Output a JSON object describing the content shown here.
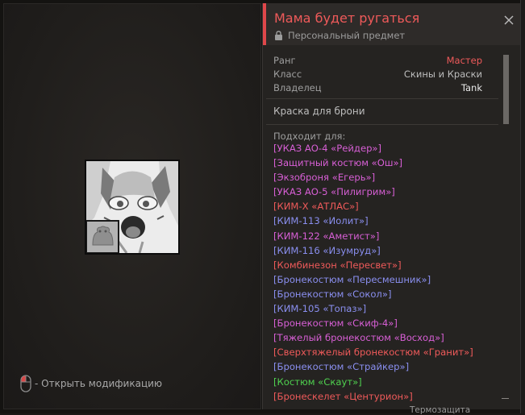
{
  "item": {
    "title": "Мама будет ругаться",
    "subtitle": "Персональный предмет",
    "properties": [
      {
        "label": "Ранг",
        "value": "Мастер"
      },
      {
        "label": "Класс",
        "value": "Скины и Краски"
      },
      {
        "label": "Владелец",
        "value": "Tank"
      }
    ],
    "description": "Краска для брони",
    "fits_label": "Подходит для:",
    "fits": [
      {
        "text": "[УКАЗ АО-4 «Рейдер»]",
        "color": "#d85fd6"
      },
      {
        "text": "[Защитный костюм «Ош»]",
        "color": "#d85fd6"
      },
      {
        "text": "[Экзоброня «Егерь»]",
        "color": "#d85fd6"
      },
      {
        "text": "[УКАЗ АО-5 «Пилигрим»]",
        "color": "#d85fd6"
      },
      {
        "text": "[КИМ-X «АТЛАС»]",
        "color": "#ef5a5a"
      },
      {
        "text": "[КИМ-113 «Иолит»]",
        "color": "#8a8ff0"
      },
      {
        "text": "[КИМ-122 «Аметист»]",
        "color": "#d85fd6"
      },
      {
        "text": "[КИМ-116 «Изумруд»]",
        "color": "#8a8ff0"
      },
      {
        "text": "[Комбинезон «Пересвет»]",
        "color": "#ef5a5a"
      },
      {
        "text": "[Бронекостюм «Пересмешник»]",
        "color": "#8a8ff0"
      },
      {
        "text": "[Бронекостюм «Сокол»]",
        "color": "#8a8ff0"
      },
      {
        "text": "[КИМ-105 «Топаз»]",
        "color": "#8a8ff0"
      },
      {
        "text": "[Бронекостюм «Скиф-4»]",
        "color": "#d85fd6"
      },
      {
        "text": "[Тяжелый бронекостюм «Восход»]",
        "color": "#d85fd6"
      },
      {
        "text": "[Сверхтяжелый бронекостюм «Гранит»]",
        "color": "#ef5a5a"
      },
      {
        "text": "[Бронекостюм «Страйкер»]",
        "color": "#8a8ff0"
      },
      {
        "text": "[Костюм «Скаут»]",
        "color": "#4fd14f"
      },
      {
        "text": "[Бронескелет «Центурион»]",
        "color": "#ef5a5a"
      }
    ]
  },
  "hint": {
    "text": "- Открыть модификацию"
  },
  "background": {
    "peek_bottom": "Термозащита"
  },
  "colors": {
    "accent": "#e0474a",
    "rank_master": "#ef5a5a"
  },
  "icons": [
    "lock-icon",
    "close-icon",
    "mouse-icon"
  ]
}
